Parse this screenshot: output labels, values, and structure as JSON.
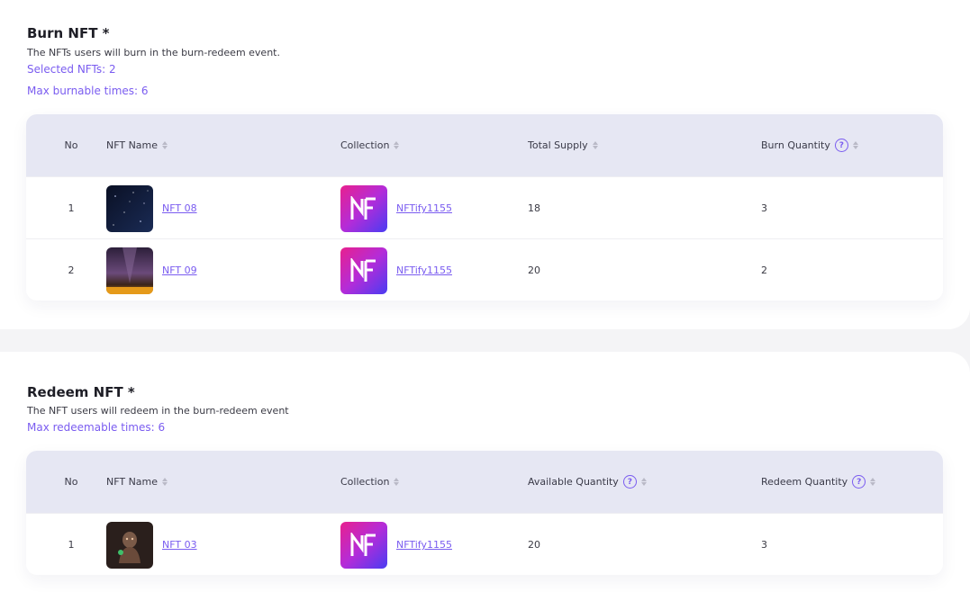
{
  "burn": {
    "title": "Burn NFT *",
    "description": "The NFTs users will burn in the burn-redeem event.",
    "selected": "Selected NFTs: 2",
    "max_times": "Max burnable times: 6",
    "headers": {
      "no": "No",
      "name": "NFT Name",
      "collection": "Collection",
      "supply": "Total Supply",
      "quantity": "Burn Quantity"
    },
    "rows": [
      {
        "no": "1",
        "name": "NFT 08",
        "collection": "NFTify1155",
        "supply": "18",
        "quantity": "3"
      },
      {
        "no": "2",
        "name": "NFT 09",
        "collection": "NFTify1155",
        "supply": "20",
        "quantity": "2"
      }
    ]
  },
  "redeem": {
    "title": "Redeem NFT *",
    "description": "The NFT users will redeem in the burn-redeem event",
    "max_times": "Max redeemable times: 6",
    "headers": {
      "no": "No",
      "name": "NFT Name",
      "collection": "Collection",
      "available": "Available Quantity",
      "quantity": "Redeem Quantity"
    },
    "rows": [
      {
        "no": "1",
        "name": "NFT 03",
        "collection": "NFTify1155",
        "available": "20",
        "quantity": "3"
      }
    ]
  },
  "colors": {
    "accent": "#7a5cf0",
    "header_bg": "#e6e7f3"
  },
  "icons": [
    "sort-icon",
    "help-circle-icon",
    "nftify-logo-icon"
  ]
}
